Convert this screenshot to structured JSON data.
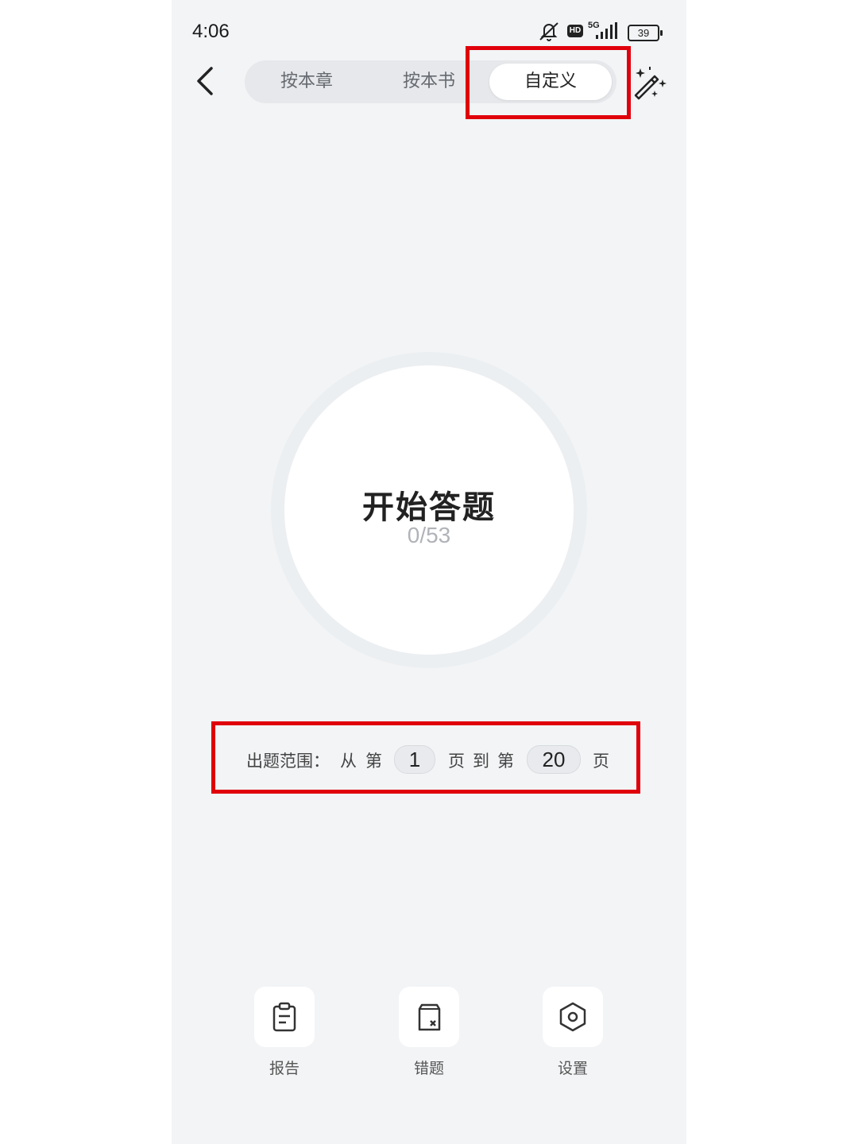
{
  "status_bar": {
    "time": "4:06",
    "network": "5G",
    "hd_badge": "HD",
    "battery": "39",
    "icons": [
      "mute-icon",
      "hd-icon",
      "signal-5g-icon",
      "battery-icon"
    ]
  },
  "header": {
    "back_icon": "chevron-left-icon",
    "tabs": [
      {
        "label": "按本章",
        "active": false
      },
      {
        "label": "按本书",
        "active": false
      },
      {
        "label": "自定义",
        "active": true
      }
    ],
    "magic_icon": "magic-wand-icon"
  },
  "start": {
    "title": "开始答题",
    "progress": "0/53"
  },
  "range": {
    "label": "出题范围：",
    "from_word": "从",
    "page_word_1": "第",
    "from_value": "1",
    "page_unit_1": "页",
    "to_word": "到",
    "page_word_2": "第",
    "to_value": "20",
    "page_unit_2": "页"
  },
  "toolbar": {
    "items": [
      {
        "label": "报告",
        "icon": "clipboard-report-icon"
      },
      {
        "label": "错题",
        "icon": "wrong-question-icon"
      },
      {
        "label": "设置",
        "icon": "settings-hexagon-icon"
      }
    ]
  },
  "colors": {
    "background": "#f2f4f6",
    "highlight": "#e0000b",
    "text": "#222222"
  }
}
